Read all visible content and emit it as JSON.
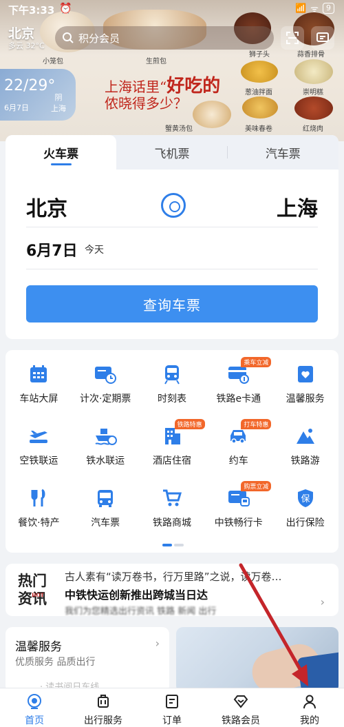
{
  "status_bar": {
    "time": "下午3:33",
    "alarm_icon": "alarm-icon",
    "battery": "9"
  },
  "header": {
    "city": "北京",
    "weather": "多云 32°C",
    "search_placeholder": "积分会员"
  },
  "banner": {
    "weather_temp": "22/29°",
    "weather_date": "6月7日",
    "weather_cond": "阴",
    "weather_city": "上海",
    "promo_line1_a": "上海话里“",
    "promo_line1_b": "好吃的",
    "promo_line2": "侬晓得多少？",
    "food_labels": [
      "小笼包",
      "生煎包",
      "狮子头",
      "蒜香排骨",
      "葱油拌面",
      "崇明糕",
      "蟹黄汤包",
      "美味春卷",
      "红烧肉"
    ]
  },
  "ticket": {
    "tabs": [
      "火车票",
      "飞机票",
      "汽车票"
    ],
    "from": "北京",
    "to": "上海",
    "date": "6月7日",
    "date_note": "今天",
    "query_button": "查询车票"
  },
  "services": [
    {
      "label": "车站大屏",
      "icon": "station-screen-icon",
      "badge": ""
    },
    {
      "label": "计次·定期票",
      "icon": "ticket-clock-icon",
      "badge": ""
    },
    {
      "label": "时刻表",
      "icon": "train-icon",
      "badge": ""
    },
    {
      "label": "铁路e卡通",
      "icon": "ecard-icon",
      "badge": "乘车立减"
    },
    {
      "label": "温馨服务",
      "icon": "heart-card-icon",
      "badge": ""
    },
    {
      "label": "空铁联运",
      "icon": "plane-train-icon",
      "badge": ""
    },
    {
      "label": "铁水联运",
      "icon": "ship-icon",
      "badge": ""
    },
    {
      "label": "酒店住宿",
      "icon": "hotel-icon",
      "badge": "铁路特惠"
    },
    {
      "label": "约车",
      "icon": "car-icon",
      "badge": "打车特惠"
    },
    {
      "label": "铁路游",
      "icon": "mountain-icon",
      "badge": ""
    },
    {
      "label": "餐饮·特产",
      "icon": "cutlery-icon",
      "badge": ""
    },
    {
      "label": "汽车票",
      "icon": "bus-icon",
      "badge": ""
    },
    {
      "label": "铁路商城",
      "icon": "cart-icon",
      "badge": ""
    },
    {
      "label": "中铁畅行卡",
      "icon": "train-card-icon",
      "badge": "购票立减"
    },
    {
      "label": "出行保险",
      "icon": "shield-icon",
      "badge": ""
    }
  ],
  "news": {
    "tag_line1": "热门",
    "tag_line2": "资讯",
    "tag_small": "HOT",
    "line1": "古人素有“读万卷书，行万里路”之说，读万卷…",
    "line2": "中铁快运创新推出跨城当日达",
    "line3": "我们为您精选出行资讯 铁路 新闻 出行"
  },
  "warm": {
    "title": "温馨服务",
    "subtitle": "优质服务 品质出行",
    "more": "·  读书阅日东线"
  },
  "bottom_nav": [
    "首页",
    "出行服务",
    "订单",
    "铁路会员",
    "我的"
  ],
  "colors": {
    "accent": "#2e7ee8",
    "button": "#3d8ff0",
    "badge": "#f2672a",
    "annotation": "#c4252a"
  }
}
